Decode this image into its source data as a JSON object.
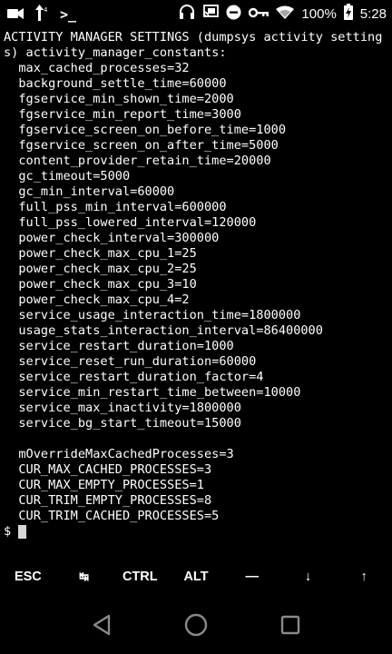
{
  "status_bar": {
    "left_icons": [
      "video-camera-icon",
      "signal-icon",
      "terminal-prompt-icon"
    ],
    "terminal_prompt_glyph": ">_",
    "right_icons": [
      "headphones-icon",
      "cast-icon",
      "do-not-disturb-icon",
      "vpn-key-icon",
      "wifi-icon",
      "battery-charging-icon"
    ],
    "battery_percent": "100%",
    "time": "5:28"
  },
  "terminal": {
    "output": "ACTIVITY MANAGER SETTINGS (dumpsys activity settings) activity_manager_constants:\n  max_cached_processes=32\n  background_settle_time=60000\n  fgservice_min_shown_time=2000\n  fgservice_min_report_time=3000\n  fgservice_screen_on_before_time=1000\n  fgservice_screen_on_after_time=5000\n  content_provider_retain_time=20000\n  gc_timeout=5000\n  gc_min_interval=60000\n  full_pss_min_interval=600000\n  full_pss_lowered_interval=120000\n  power_check_interval=300000\n  power_check_max_cpu_1=25\n  power_check_max_cpu_2=25\n  power_check_max_cpu_3=10\n  power_check_max_cpu_4=2\n  service_usage_interaction_time=1800000\n  usage_stats_interaction_interval=86400000\n  service_restart_duration=1000\n  service_reset_run_duration=60000\n  service_restart_duration_factor=4\n  service_min_restart_time_between=10000\n  service_max_inactivity=1800000\n  service_bg_start_timeout=15000\n\n  mOverrideMaxCachedProcesses=3\n  CUR_MAX_CACHED_PROCESSES=3\n  CUR_MAX_EMPTY_PROCESSES=1\n  CUR_TRIM_EMPTY_PROCESSES=8\n  CUR_TRIM_CACHED_PROCESSES=5",
    "prompt": "$"
  },
  "extra_keys": [
    {
      "label": "ESC",
      "name": "esc-key"
    },
    {
      "label": "↹",
      "name": "tab-key"
    },
    {
      "label": "CTRL",
      "name": "ctrl-key"
    },
    {
      "label": "ALT",
      "name": "alt-key"
    },
    {
      "label": "—",
      "name": "dash-key"
    },
    {
      "label": "↓",
      "name": "down-arrow-key"
    },
    {
      "label": "↑",
      "name": "up-arrow-key"
    }
  ],
  "nav_bar": {
    "buttons": [
      "back-icon",
      "home-icon",
      "recents-icon"
    ],
    "icon_color": "#8a8a8a"
  },
  "colors": {
    "background": "#000000",
    "text": "#ffffff",
    "cursor": "#d8d8d8"
  }
}
